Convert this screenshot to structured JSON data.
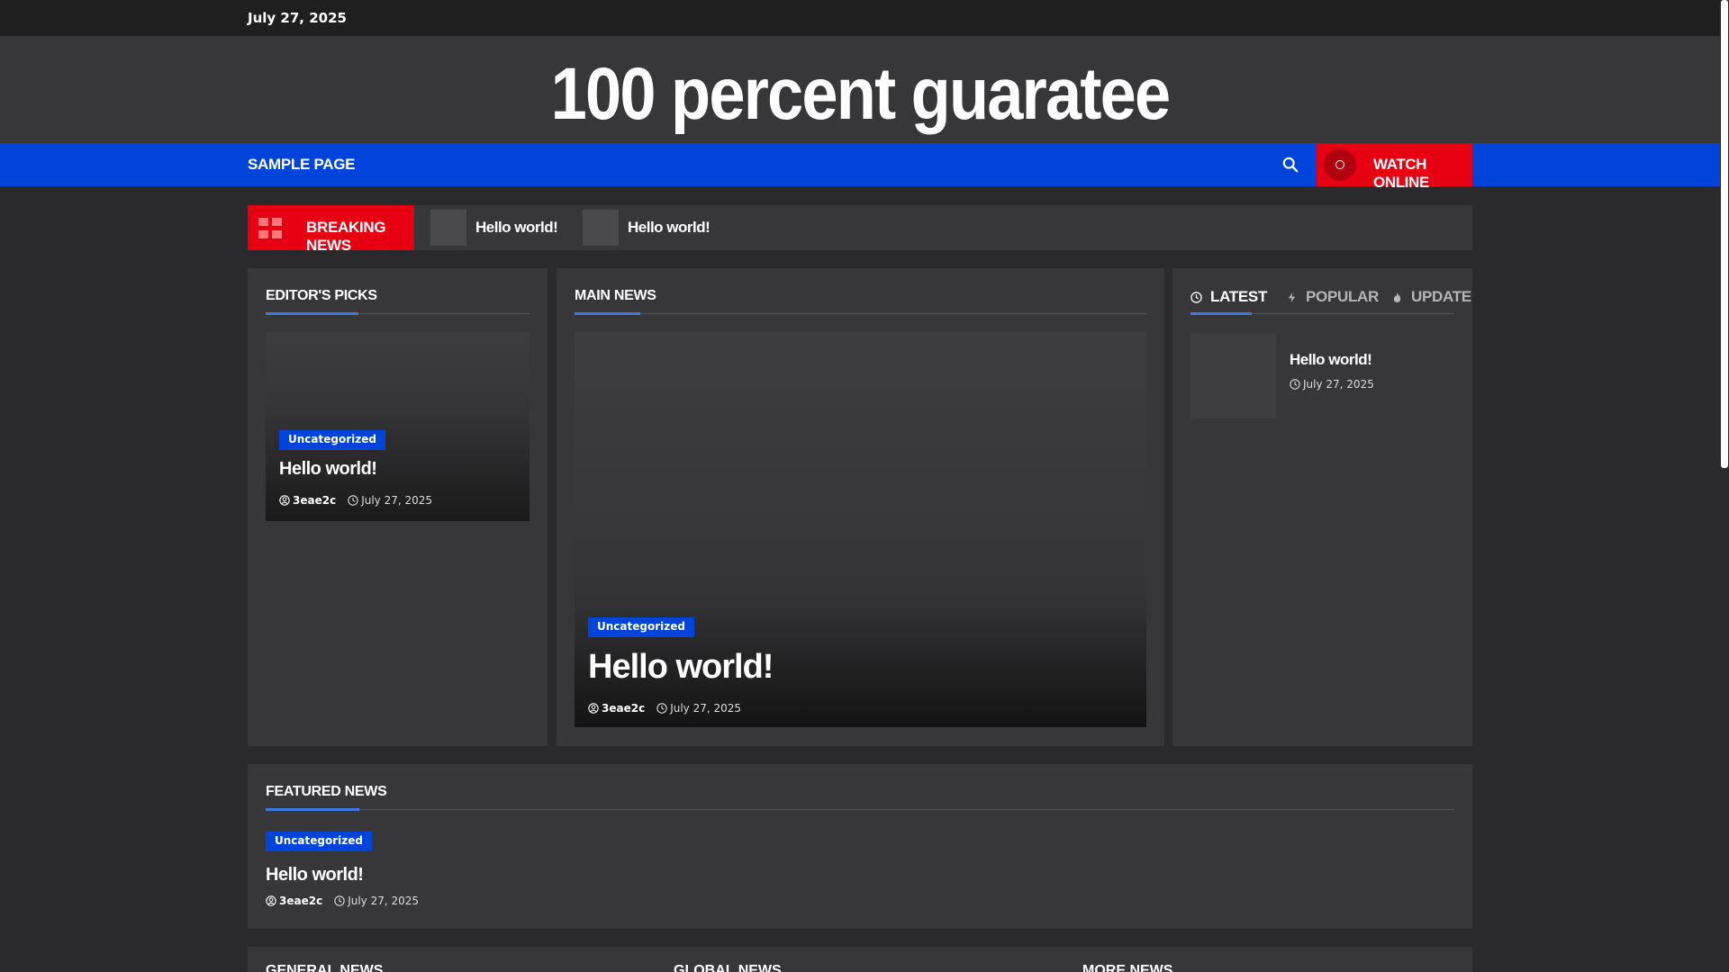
{
  "topbar": {
    "date": "July 27, 2025"
  },
  "header": {
    "site_title": "100 percent guaratee"
  },
  "nav": {
    "items": [
      {
        "label": "SAMPLE PAGE"
      }
    ],
    "watch_label": "WATCH ONLINE"
  },
  "breaking": {
    "label": "BREAKING NEWS",
    "items": [
      {
        "title": "Hello world!"
      },
      {
        "title": "Hello world!"
      }
    ]
  },
  "editors_picks": {
    "title": "EDITOR'S PICKS",
    "card": {
      "category": "Uncategorized",
      "title": "Hello world!",
      "author": "3eae2c",
      "date": "July 27, 2025"
    }
  },
  "main_news": {
    "title": "MAIN NEWS",
    "card": {
      "category": "Uncategorized",
      "title": "Hello world!",
      "author": "3eae2c",
      "date": "July 27, 2025"
    }
  },
  "tabs_panel": {
    "tabs": [
      {
        "label": "LATEST",
        "icon": "clock-icon",
        "active": true
      },
      {
        "label": "POPULAR",
        "icon": "bolt-icon",
        "active": false
      },
      {
        "label": "UPDATE",
        "icon": "fire-icon",
        "active": false
      }
    ],
    "latest_item": {
      "title": "Hello world!",
      "date": "July 27, 2025"
    }
  },
  "featured": {
    "title": "FEATURED NEWS",
    "item": {
      "category": "Uncategorized",
      "title": "Hello world!",
      "author": "3eae2c",
      "date": "July 27, 2025"
    }
  },
  "bottom": {
    "titles": [
      "GENERAL NEWS",
      "GLOBAL NEWS",
      "MORE NEWS"
    ]
  },
  "colors": {
    "accent_blue": "#0044db",
    "accent_red": "#e60012",
    "underline": "#3b7be0",
    "panel": "#37373a",
    "bg": "#2a2a2d"
  }
}
